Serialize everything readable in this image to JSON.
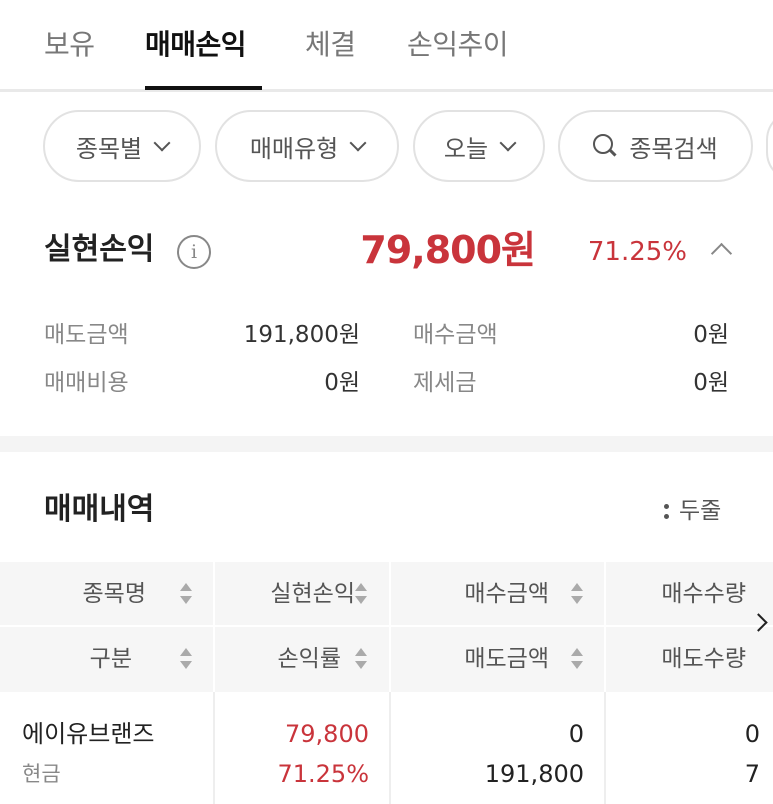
{
  "tabs": [
    {
      "label": "보유",
      "active": false
    },
    {
      "label": "매매손익",
      "active": true
    },
    {
      "label": "체결",
      "active": false
    },
    {
      "label": "손익추이",
      "active": false
    }
  ],
  "filters": {
    "by_stock": "종목별",
    "trade_type": "매매유형",
    "period": "오늘",
    "search": "종목검색"
  },
  "summary": {
    "label": "실현손익",
    "info_glyph": "i",
    "amount": "79,800원",
    "rate": "71.25%",
    "rows": [
      {
        "label": "매도금액",
        "value": "191,800원"
      },
      {
        "label": "매수금액",
        "value": "0원"
      },
      {
        "label": "매매비용",
        "value": "0원"
      },
      {
        "label": "제세금",
        "value": "0원"
      }
    ]
  },
  "history": {
    "title": "매매내역",
    "view_toggle": "두줄",
    "headers": {
      "row1": [
        "종목명",
        "실현손익",
        "매수금액",
        "매수수량"
      ],
      "row2": [
        "구분",
        "손익률",
        "매도금액",
        "매도수량"
      ]
    },
    "rows": [
      {
        "name": "에이유브랜즈",
        "type": "현금",
        "pl": "79,800",
        "rate": "71.25%",
        "buy_amount": "0",
        "sell_amount": "191,800",
        "buy_qty": "0",
        "sell_qty": "7"
      }
    ]
  },
  "colors": {
    "gain": "#c9343b",
    "text": "#222222",
    "muted": "#888888",
    "header_bg": "#f6f6f6"
  }
}
